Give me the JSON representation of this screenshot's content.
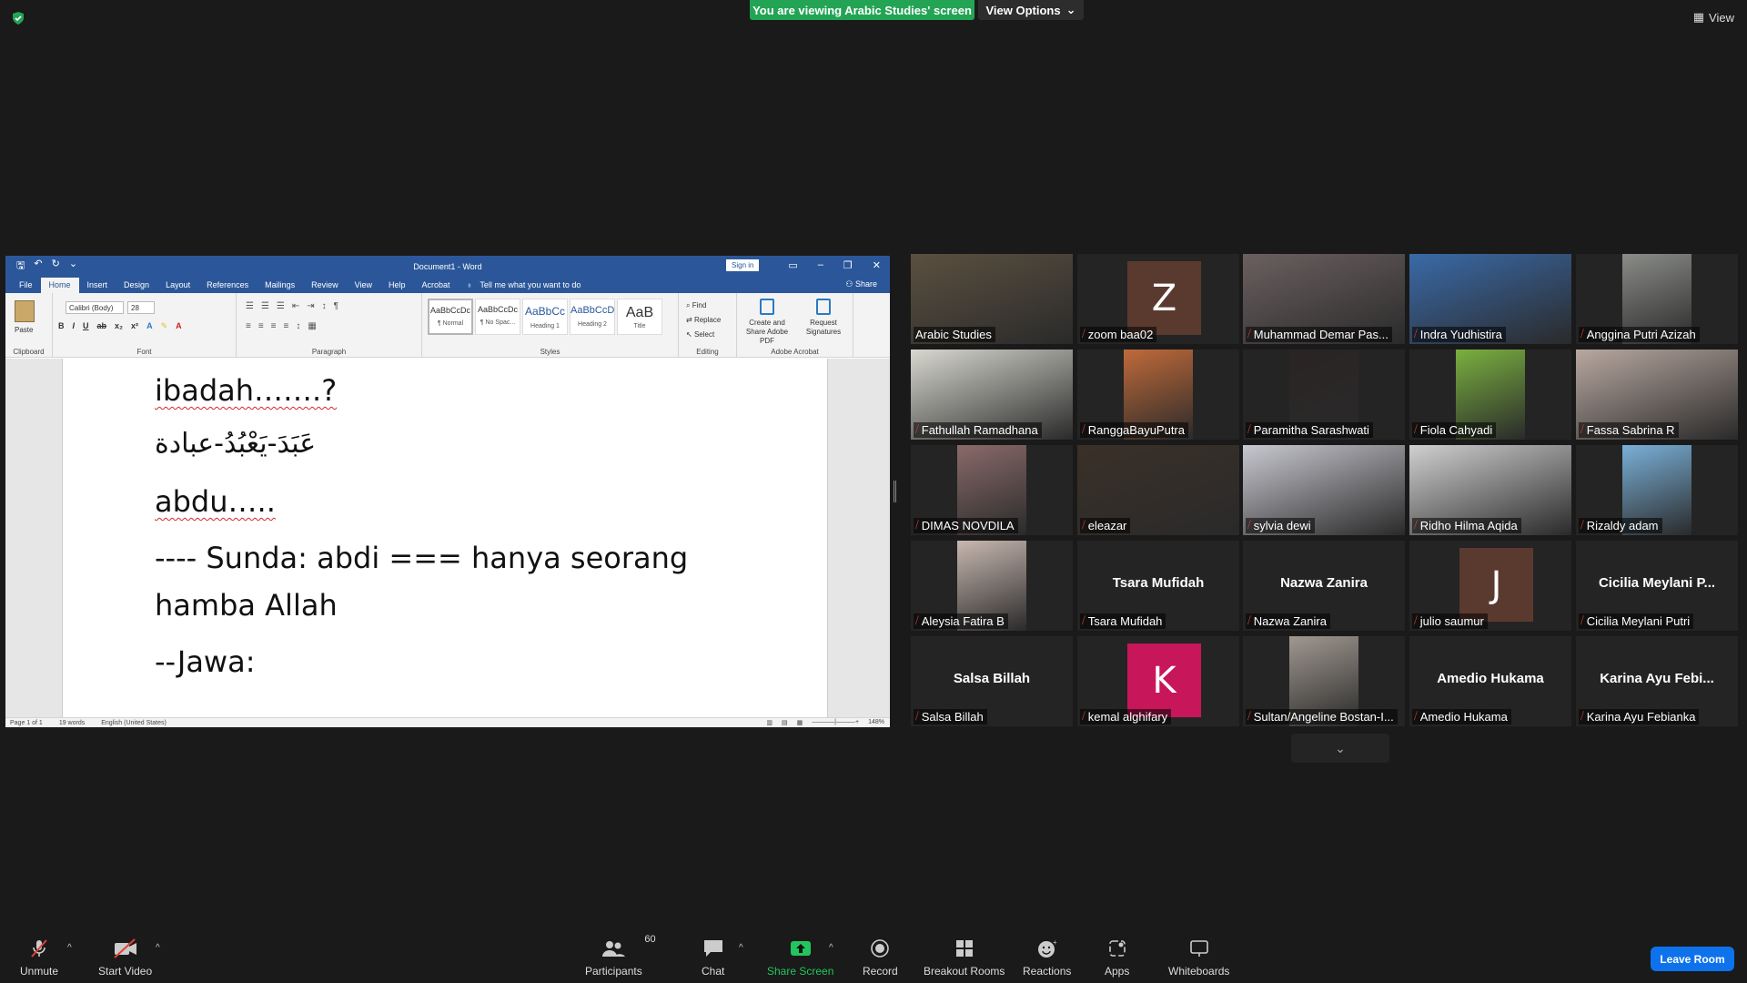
{
  "top": {
    "viewing_banner": "You are viewing Arabic Studies' screen",
    "view_options": "View Options",
    "view_button": "View"
  },
  "word": {
    "title": "Document1 - Word",
    "sign_in": "Sign in",
    "tabs": [
      "File",
      "Home",
      "Insert",
      "Design",
      "Layout",
      "References",
      "Mailings",
      "Review",
      "View",
      "Help",
      "Acrobat"
    ],
    "tell_me": "Tell me what you want to do",
    "share": "Share",
    "ribbon": {
      "paste": "Paste",
      "font_name": "Calibri (Body)",
      "font_size": "28",
      "groups": [
        "Clipboard",
        "Font",
        "Paragraph",
        "Styles",
        "Editing",
        "Adobe Acrobat"
      ],
      "styles": [
        {
          "sample": "AaBbCcDc",
          "name": "¶ Normal"
        },
        {
          "sample": "AaBbCcDc",
          "name": "¶ No Spac..."
        },
        {
          "sample": "AaBbCc",
          "name": "Heading 1"
        },
        {
          "sample": "AaBbCcD",
          "name": "Heading 2"
        },
        {
          "sample": "AaB",
          "name": "Title"
        }
      ],
      "editing": [
        "Find",
        "Replace",
        "Select"
      ],
      "adobe": [
        "Create and Share Adobe PDF",
        "Request Signatures"
      ]
    },
    "lines": [
      "ibadah…….?",
      "عَبَدَ-يَعْبُدُ-عبادة",
      "abdu…..",
      "---- Sunda: abdi === hanya seorang",
      "hamba Allah",
      "--Jawa:"
    ],
    "status": {
      "page": "Page 1 of 1",
      "words": "19 words",
      "language": "English (United States)",
      "zoom": "148%"
    }
  },
  "participants": [
    {
      "name": "Arabic Studies",
      "type": "video",
      "muted": false,
      "speaking": true,
      "color": "#5b5040"
    },
    {
      "name": "zoom baa02",
      "type": "avatar",
      "letter": "Z",
      "color": "#5a3a2f"
    },
    {
      "name": "Muhammad Demar Pas...",
      "type": "video",
      "color": "#6b6060"
    },
    {
      "name": "Indra Yudhistira",
      "type": "video",
      "color": "#3a6aa8"
    },
    {
      "name": "Anggina Putri Azizah",
      "type": "video",
      "color": "#8a8c88"
    },
    {
      "name": "Fathullah Ramadhana",
      "type": "video",
      "color": "#d8d8d0"
    },
    {
      "name": "RanggaBayuPutra",
      "type": "video",
      "color": "#c06a3a"
    },
    {
      "name": "Paramitha Sarashwati",
      "type": "video",
      "color": "#2a2424"
    },
    {
      "name": "Fiola Cahyadi",
      "type": "video",
      "color": "#7ab040"
    },
    {
      "name": "Fassa Sabrina R",
      "type": "video",
      "color": "#b8a8a0"
    },
    {
      "name": "DIMAS NOVDILA",
      "type": "video",
      "color": "#8a6a6a"
    },
    {
      "name": "eleazar",
      "type": "video",
      "color": "#3a3028"
    },
    {
      "name": "sylvia dewi",
      "type": "video",
      "color": "#c8c8d0"
    },
    {
      "name": "Ridho Hilma Aqida",
      "type": "video",
      "color": "#d0d0d0"
    },
    {
      "name": "Rizaldy adam",
      "type": "video",
      "color": "#7ab0d8"
    },
    {
      "name": "Aleysia Fatira B",
      "type": "video",
      "color": "#c8b8b0"
    },
    {
      "name": "Tsara Mufidah",
      "type": "name"
    },
    {
      "name": "Nazwa Zanira",
      "type": "name"
    },
    {
      "name": "julio saumur",
      "type": "avatar",
      "letter": "J",
      "color": "#5a3a2f"
    },
    {
      "name": "Cicilia Meylani Putri",
      "type": "name",
      "big": "Cicilia  Meylani  P..."
    },
    {
      "name": "Salsa Billah",
      "type": "name"
    },
    {
      "name": "kemal alghifary",
      "type": "avatar",
      "letter": "K",
      "color": "#c8165a"
    },
    {
      "name": "Sultan/Angeline Bostan-I...",
      "type": "video",
      "color": "#a09890"
    },
    {
      "name": "Amedio Hukama",
      "type": "name"
    },
    {
      "name": "Karina Ayu Febianka",
      "type": "name",
      "big": "Karina  Ayu  Febi..."
    }
  ],
  "toolbar": {
    "unmute": "Unmute",
    "start_video": "Start Video",
    "participants": "Participants",
    "participant_count": "60",
    "chat": "Chat",
    "share_screen": "Share Screen",
    "record": "Record",
    "breakout": "Breakout Rooms",
    "reactions": "Reactions",
    "apps": "Apps",
    "whiteboards": "Whiteboards",
    "leave": "Leave Room"
  },
  "colors": {
    "banner_green": "#23a455",
    "word_blue": "#2b579a",
    "leave_blue": "#0e72ed",
    "speaker_yellow": "#f0d23a",
    "muted_red": "#e0413a"
  }
}
